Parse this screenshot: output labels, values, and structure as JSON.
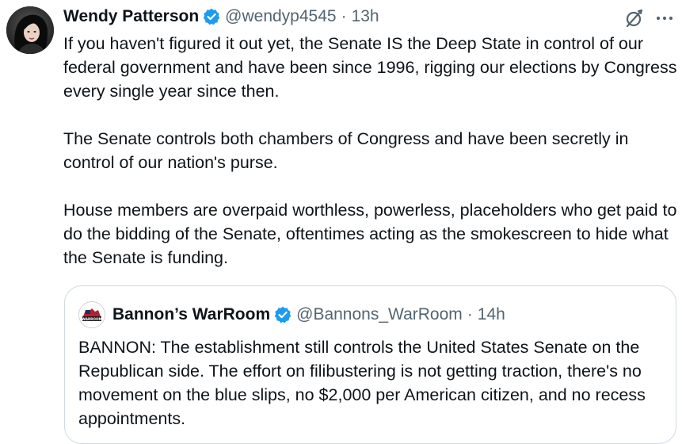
{
  "tweet": {
    "author_name": "Wendy Patterson",
    "handle": "@wendyp4545",
    "separator": "·",
    "time": "13h",
    "paragraphs": [
      "If you haven't figured it out yet, the Senate IS the Deep State in control of our federal government and have been since 1996, rigging our elections by Congress every single year since then.",
      "The Senate controls both chambers of Congress and have been secretly in control of our nation's purse.",
      "House members are overpaid worthless, powerless, placeholders who get paid to do the bidding of the Senate, oftentimes acting as the smokescreen to hide what the Senate is funding."
    ]
  },
  "quote": {
    "author_name": "Bannon’s WarRoom",
    "handle": "@Bannons_WarRoom",
    "separator": "·",
    "time": "14h",
    "text": "BANNON: The establishment still controls the United States Senate on the Republican side. The effort on filibustering is not getting traction, there's no movement on the blue slips, no $2,000 per American citizen, and no recess appointments.",
    "avatar_logo_text": "WARROOM"
  },
  "icons": {
    "verified": "verified-badge-icon",
    "grok": "grok-icon",
    "more": "more-options-icon"
  },
  "colors": {
    "verified_blue": "#1d9bf0",
    "secondary_text": "#536471",
    "border": "#cfd9de"
  }
}
